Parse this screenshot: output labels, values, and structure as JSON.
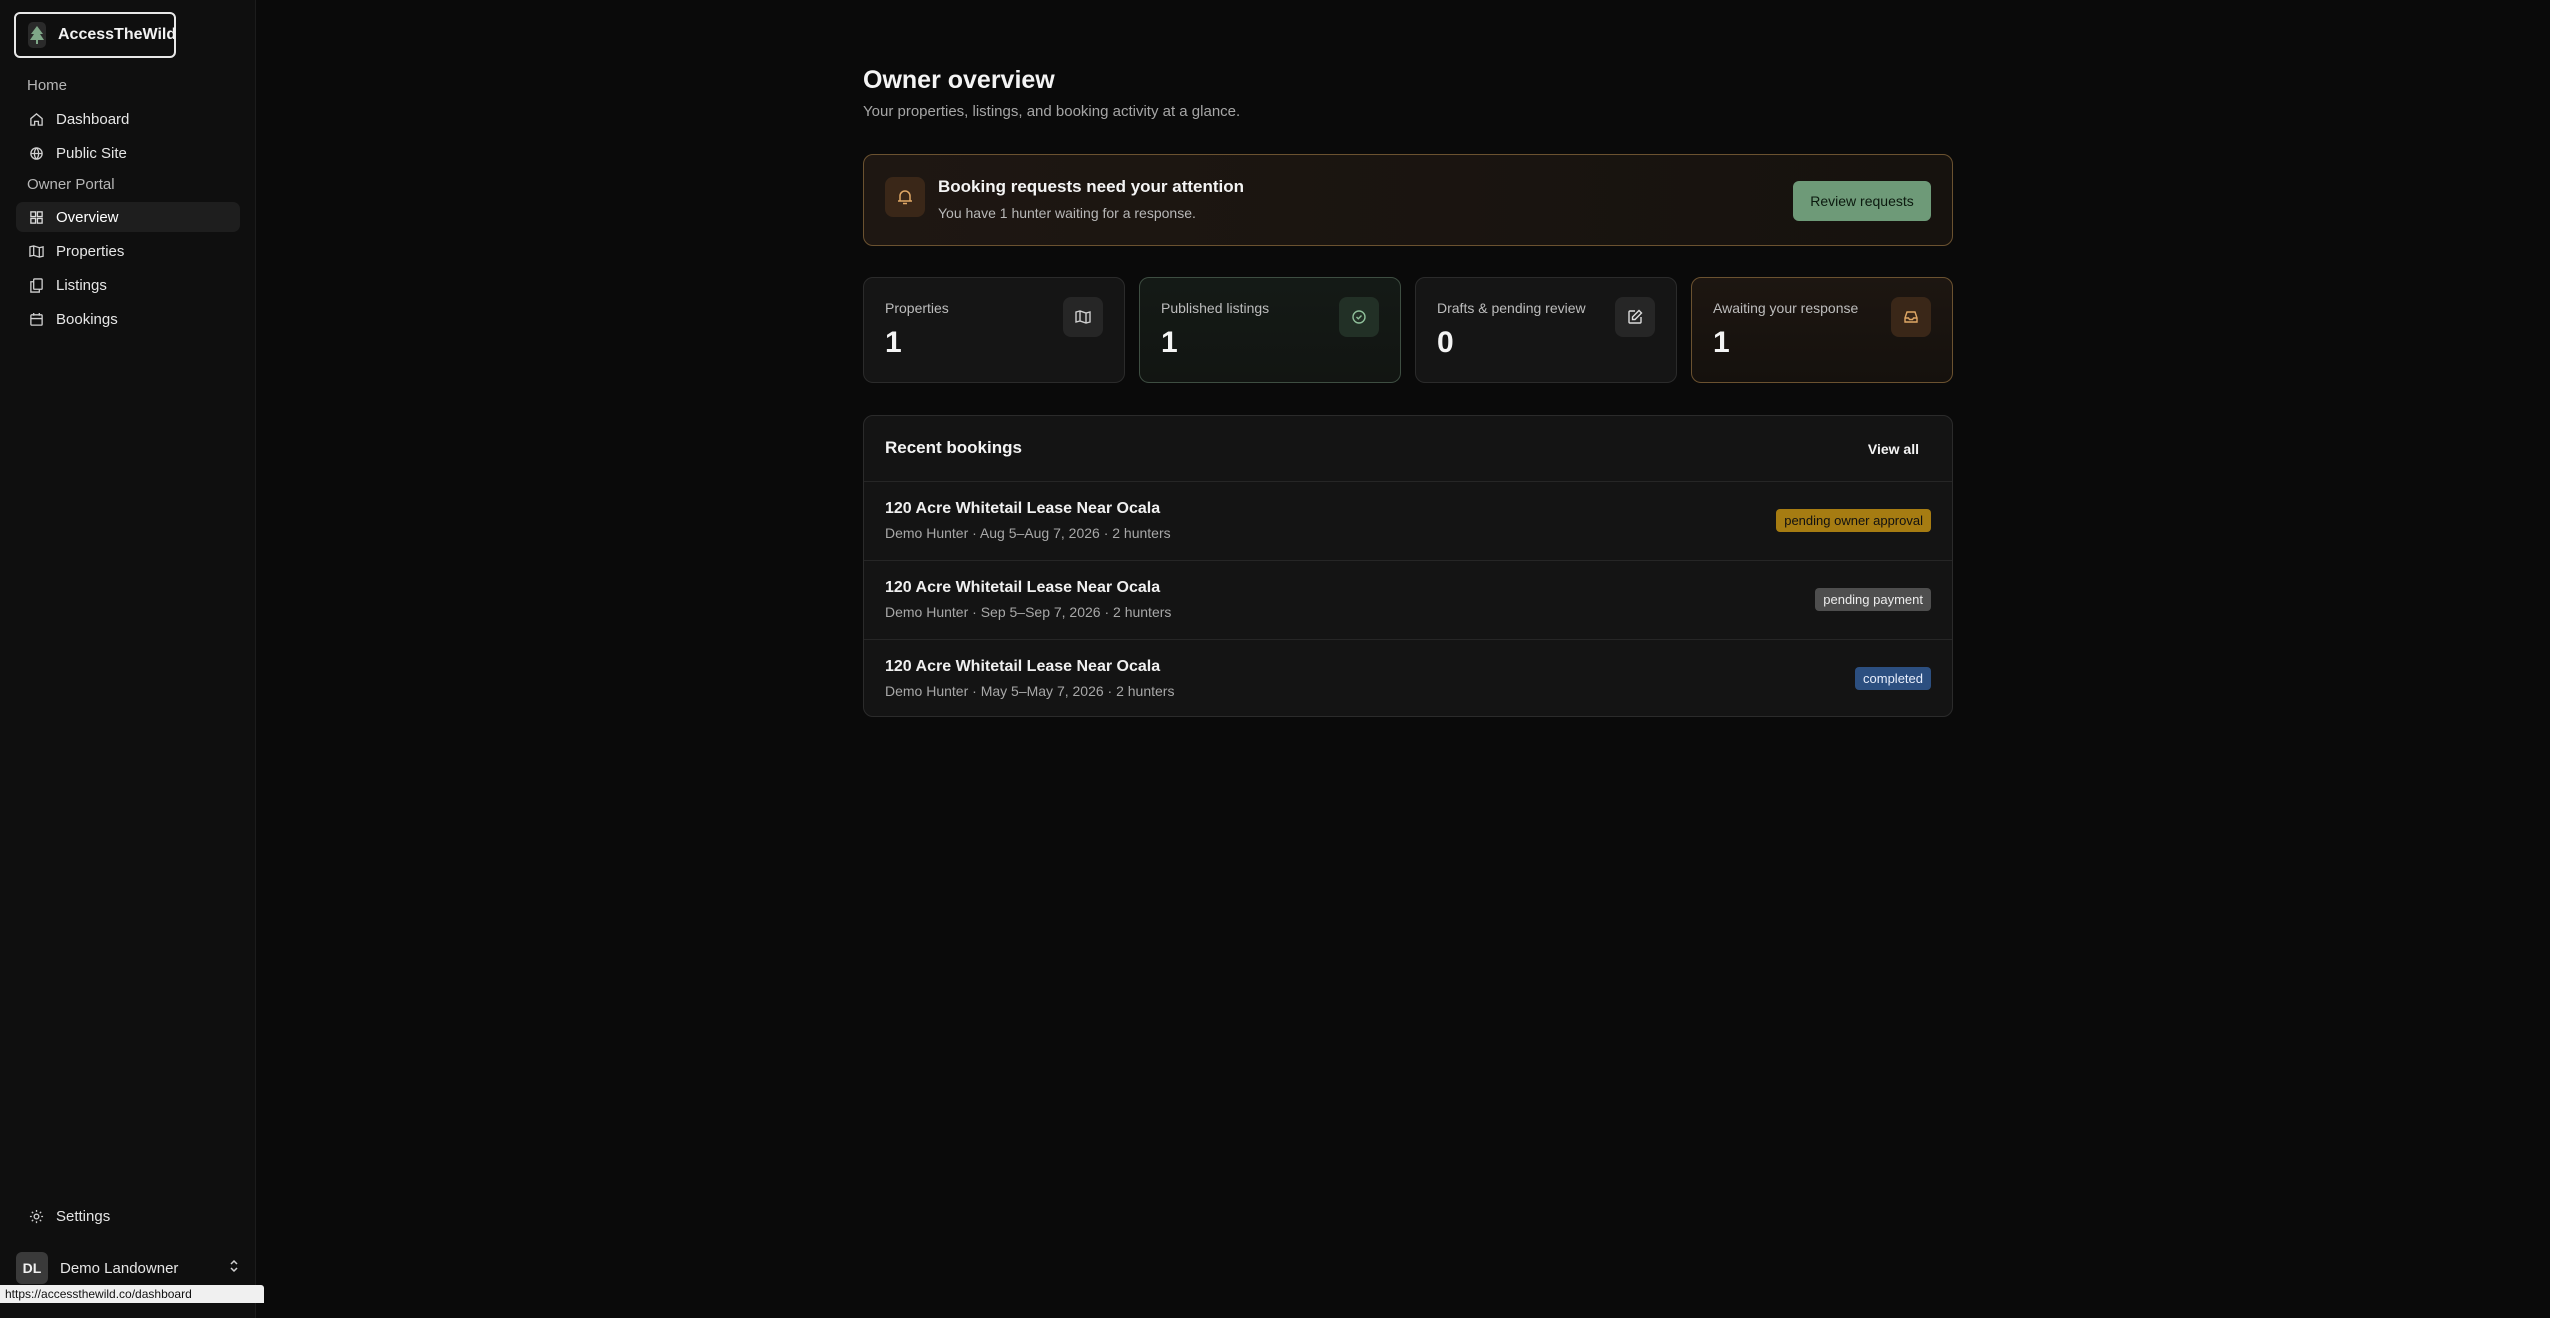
{
  "brand": {
    "name": "AccessTheWild"
  },
  "sidebar": {
    "group_home": "Home",
    "group_owner": "Owner Portal",
    "items": [
      {
        "label": "Dashboard",
        "icon": "home-icon"
      },
      {
        "label": "Public Site",
        "icon": "globe-icon"
      },
      {
        "label": "Overview",
        "icon": "grid-icon",
        "active": true
      },
      {
        "label": "Properties",
        "icon": "map-icon"
      },
      {
        "label": "Listings",
        "icon": "copy-icon"
      },
      {
        "label": "Bookings",
        "icon": "calendar-icon"
      }
    ],
    "settings_label": "Settings",
    "user": {
      "initials": "DL",
      "name": "Demo Landowner"
    }
  },
  "status_url": "https://accessthewild.co/dashboard",
  "page": {
    "title": "Owner overview",
    "subtitle": "Your properties, listings, and booking activity at a glance."
  },
  "alert": {
    "title": "Booking requests need your attention",
    "text": "You have 1 hunter waiting for a response.",
    "button": "Review requests"
  },
  "stats": [
    {
      "label": "Properties",
      "value": "1",
      "icon": "map-icon"
    },
    {
      "label": "Published listings",
      "value": "1",
      "icon": "check-circle-icon"
    },
    {
      "label": "Drafts & pending review",
      "value": "0",
      "icon": "edit-icon"
    },
    {
      "label": "Awaiting your response",
      "value": "1",
      "icon": "inbox-icon"
    }
  ],
  "recent": {
    "title": "Recent bookings",
    "view_all": "View all",
    "rows": [
      {
        "name": "120 Acre Whitetail Lease Near Ocala",
        "meta": "Demo Hunter · Aug 5–Aug 7, 2026 · 2 hunters",
        "status": "pending owner approval"
      },
      {
        "name": "120 Acre Whitetail Lease Near Ocala",
        "meta": "Demo Hunter · Sep 5–Sep 7, 2026 · 2 hunters",
        "status": "pending payment"
      },
      {
        "name": "120 Acre Whitetail Lease Near Ocala",
        "meta": "Demo Hunter · May 5–May 7, 2026 · 2 hunters",
        "status": "completed"
      }
    ]
  },
  "colors": {
    "accent_green": "#6e9a78",
    "amber_border": "#6b5230",
    "badge_amber": "#a67c12",
    "badge_gray": "#4e4e4e",
    "badge_blue": "#2c4f80"
  }
}
